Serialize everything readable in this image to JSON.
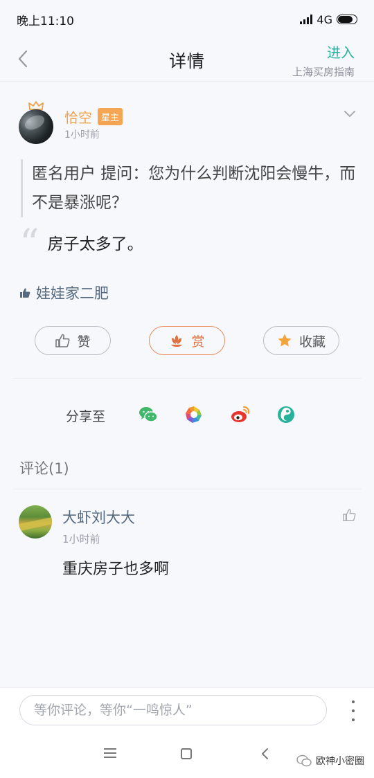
{
  "status_bar": {
    "time": "晚上11:10",
    "network": "4G",
    "battery_level": 0.8
  },
  "header": {
    "title": "详情",
    "enter_label": "进入",
    "channel_name": "上海买房指南"
  },
  "post": {
    "username": "恰空",
    "badge": "星主",
    "time": "1小时前",
    "question": "匿名用户  提问：您为什么判断沈阳会慢牛，而不是暴涨呢？",
    "answer": "房子太多了。",
    "liker": "娃娃家二肥",
    "actions": {
      "like": "赞",
      "reward": "赏",
      "favorite": "收藏"
    }
  },
  "share": {
    "label": "分享至"
  },
  "comments": {
    "heading": "评论(1)",
    "items": [
      {
        "user": "大虾刘大大",
        "time": "1小时前",
        "text": "重庆房子也多啊"
      }
    ]
  },
  "input": {
    "placeholder": "等你评论，等你“一鸣惊人”"
  },
  "watermark": "欧神小密圈",
  "colors": {
    "accent": "#2bb3a3",
    "username": "#f0a04b",
    "reward": "#e0703d",
    "link": "#556a80"
  }
}
